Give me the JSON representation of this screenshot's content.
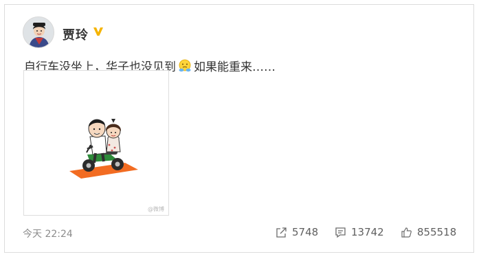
{
  "user": {
    "name": "贾玲",
    "verified_icon": "verified-badge-icon",
    "avatar_icon": "avatar-icon"
  },
  "post": {
    "text_before_emoji": "自行车没坐上，华子也没见到",
    "emoji": "sad-face-emoji",
    "text_after_emoji": "如果能重来……",
    "image_watermark": "@微博"
  },
  "meta": {
    "timestamp": "今天 22:24"
  },
  "actions": {
    "repost": {
      "icon": "share-icon",
      "count": "5748"
    },
    "comment": {
      "icon": "comment-icon",
      "count": "13742"
    },
    "like": {
      "icon": "thumbs-up-icon",
      "count": "855518"
    }
  },
  "colors": {
    "verified": "#f5b400",
    "text": "#333333",
    "muted": "#8c8c8c",
    "scooter_mat": "#f26c22"
  }
}
